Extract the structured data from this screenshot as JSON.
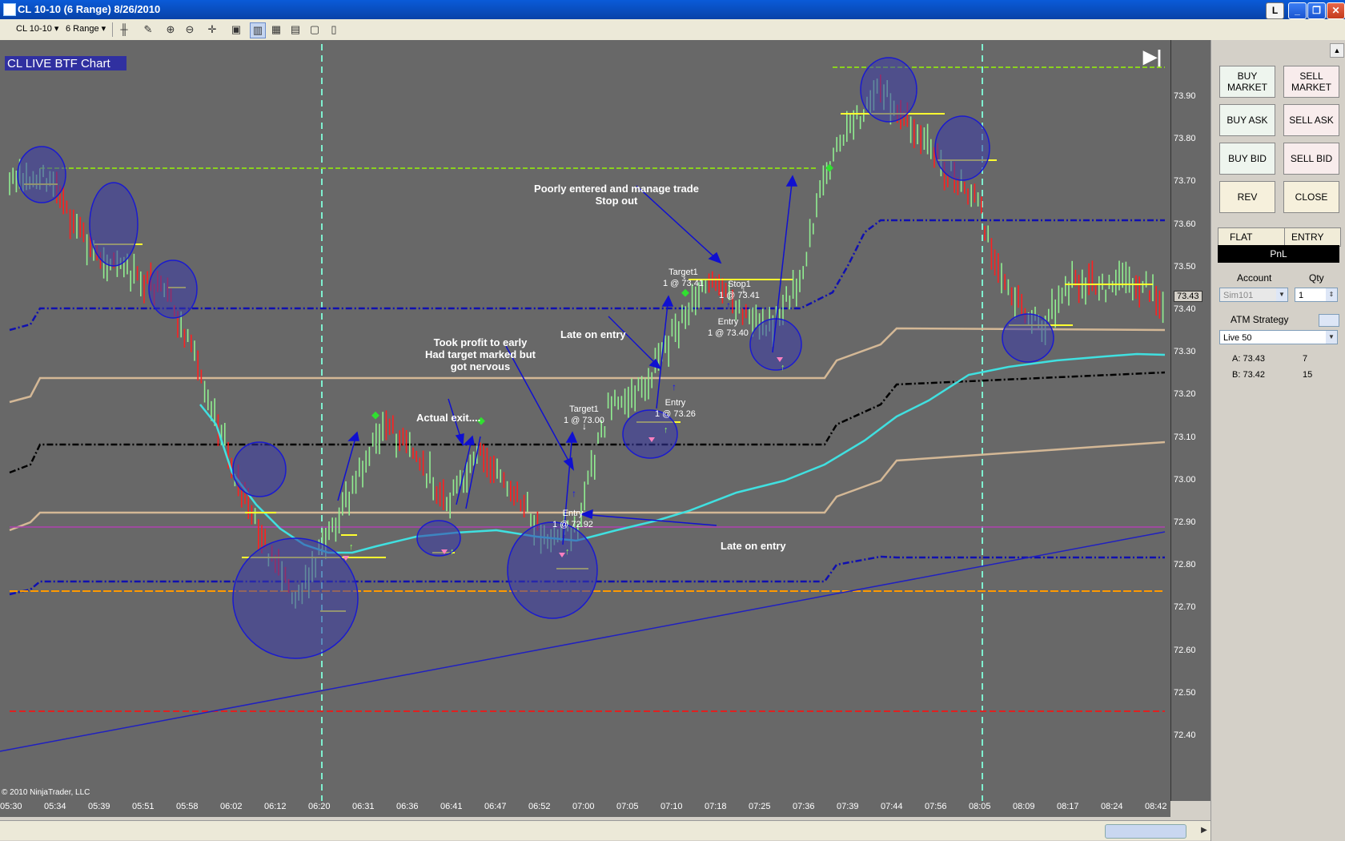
{
  "window": {
    "title": "CL 10-10 (6 Range)  8/26/2010",
    "btn_l": "L"
  },
  "toolbar": {
    "instrument": "CL 10-10",
    "period": "6 Range"
  },
  "chart": {
    "title": "CL LIVE BTF Chart",
    "copyright": "© 2010 NinjaTrader, LLC",
    "price_tag": "73.43",
    "y_ticks": [
      "73.90",
      "73.80",
      "73.70",
      "73.60",
      "73.50",
      "73.40",
      "73.30",
      "73.20",
      "73.10",
      "73.00",
      "72.90",
      "72.80",
      "72.70",
      "72.60",
      "72.50",
      "72.40"
    ],
    "x_ticks": [
      "05:30",
      "05:34",
      "05:39",
      "05:51",
      "05:58",
      "06:02",
      "06:12",
      "06:20",
      "06:31",
      "06:36",
      "06:41",
      "06:47",
      "06:52",
      "07:00",
      "07:05",
      "07:10",
      "07:18",
      "07:25",
      "07:36",
      "07:39",
      "07:44",
      "07:56",
      "08:05",
      "08:09",
      "08:17",
      "08:24",
      "08:42"
    ],
    "annotations": {
      "poorly1": "Poorly entered and manage trade",
      "poorly2": "Stop out",
      "took1": "Took profit to early",
      "took2": "Had target marked but",
      "took3": "got nervous",
      "late1": "Late on entry",
      "actual": "Actual exit....",
      "late2": "Late on entry"
    },
    "orders": {
      "t1a": "Target1",
      "t1b": "1 @ 73.41",
      "s1a": "Stop1",
      "s1b": "1 @ 73.41",
      "e1a": "Entry",
      "e1b": "1 @ 73.40",
      "e2a": "Entry",
      "e2b": "1 @ 73.26",
      "t2a": "Target1",
      "t2b": "1 @ 73.00",
      "e3a": "Entry",
      "e3b": "1 @ 72.92"
    }
  },
  "panel": {
    "buy_market": "BUY MARKET",
    "sell_market": "SELL MARKET",
    "buy_ask": "BUY ASK",
    "sell_ask": "SELL ASK",
    "buy_bid": "BUY BID",
    "sell_bid": "SELL BID",
    "rev": "REV",
    "close": "CLOSE",
    "flat": "FLAT",
    "entry": "ENTRY",
    "pnl": "PnL",
    "account_label": "Account",
    "qty_label": "Qty",
    "account_value": "Sim101",
    "qty_value": "1",
    "atm_label": "ATM Strategy",
    "atm_value": "Live 50",
    "ask": "A: 73.43",
    "ask_size": "7",
    "bid": "B: 73.42",
    "bid_size": "15"
  },
  "colors": {
    "up_bar": "#90ee90",
    "down_bar": "#ff2020",
    "background": "#686868",
    "circles": "#2a2ab0",
    "ema": "#40e0e0"
  }
}
